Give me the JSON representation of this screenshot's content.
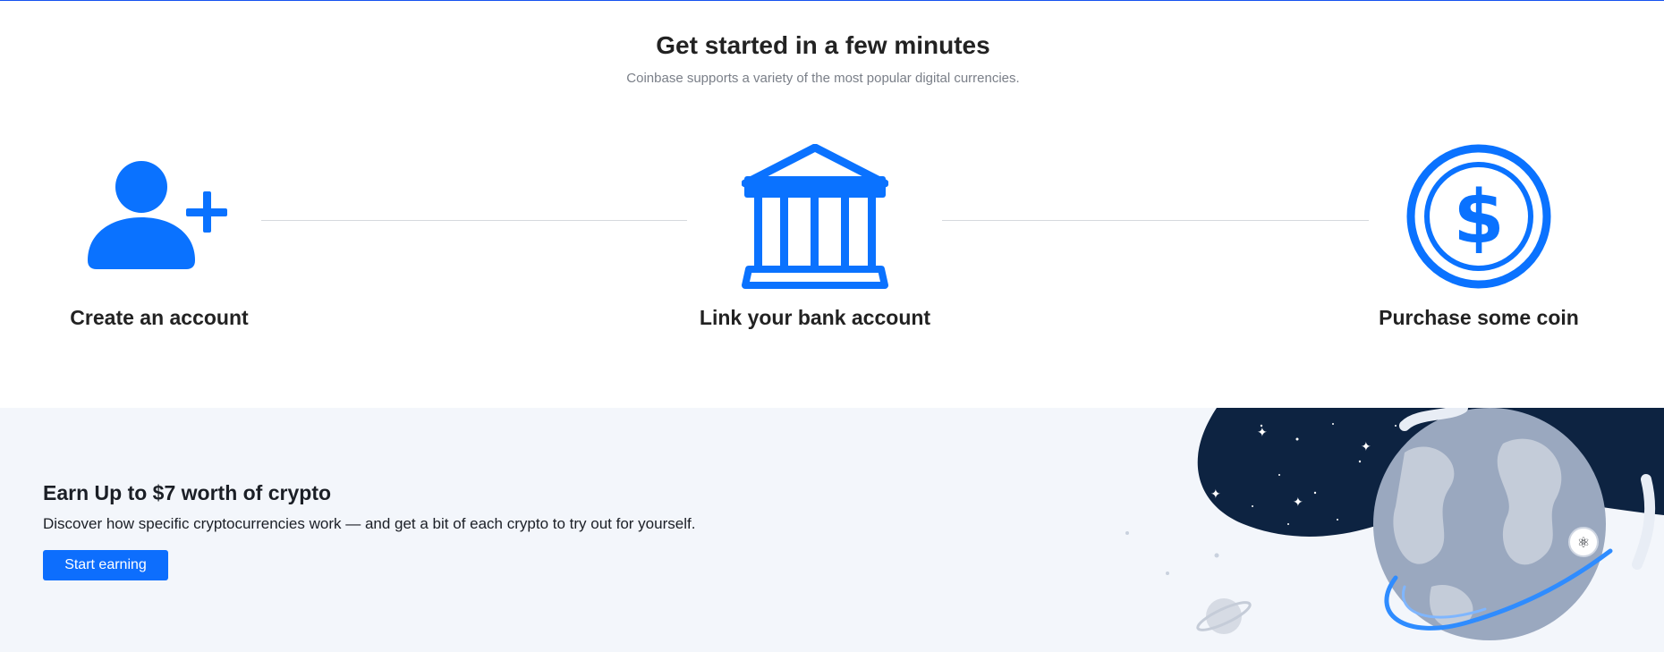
{
  "header": {
    "title": "Get started in a few minutes",
    "subtitle": "Coinbase supports a variety of the most popular digital currencies."
  },
  "steps": [
    {
      "label": "Create an account",
      "icon": "add-user-icon"
    },
    {
      "label": "Link your bank account",
      "icon": "bank-icon"
    },
    {
      "label": "Purchase some coin",
      "icon": "dollar-coin-icon"
    }
  ],
  "promo": {
    "title": "Earn Up to $7 worth of crypto",
    "description": "Discover how specific cryptocurrencies work — and get a bit of each crypto to try out for yourself.",
    "button_label": "Start earning",
    "illustration": "space-earth-illustration"
  },
  "colors": {
    "accent": "#0d6efd",
    "icon_blue": "#0a72ff",
    "promo_background": "#f3f6fb",
    "space_dark": "#0d2341"
  }
}
